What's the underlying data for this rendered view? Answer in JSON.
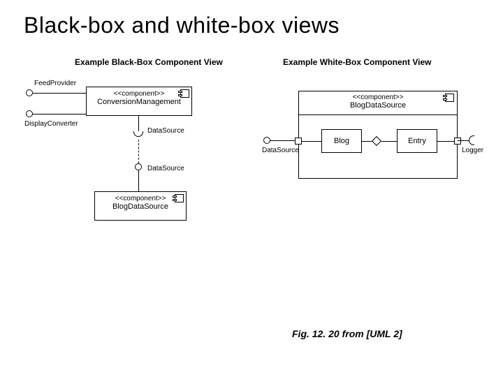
{
  "title": "Black-box and white-box views",
  "left": {
    "heading": "Example Black-Box Component View",
    "iface1": "FeedProvider",
    "iface2": "DisplayConverter",
    "comp1_stereo": "<<component>>",
    "comp1_name": "ConversionManagement",
    "ds1": "DataSource",
    "ds2": "DataSource",
    "comp2_stereo": "<<component>>",
    "comp2_name": "BlogDataSource"
  },
  "right": {
    "heading": "Example White-Box Component View",
    "comp_stereo": "<<component>>",
    "comp_name": "BlogDataSource",
    "inner1": "Blog",
    "inner2": "Entry",
    "left_iface": "DataSource",
    "right_iface": "Logger"
  },
  "caption": "Fig. 12. 20  from [UML 2]"
}
